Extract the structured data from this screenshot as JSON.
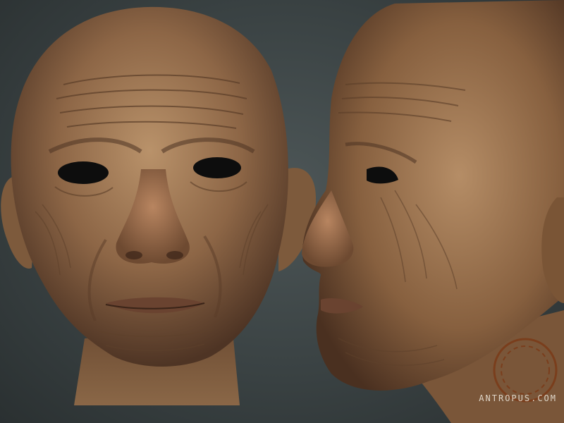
{
  "watermark": {
    "text": "ANTROPUS.COM"
  },
  "palette": {
    "background": "#3a4243",
    "skin_light": "#b58a5e",
    "skin_mid": "#8a6240",
    "skin_dark": "#4a3020",
    "eye_void": "#0d0d0d",
    "logo_ring": "#7a3a18"
  }
}
